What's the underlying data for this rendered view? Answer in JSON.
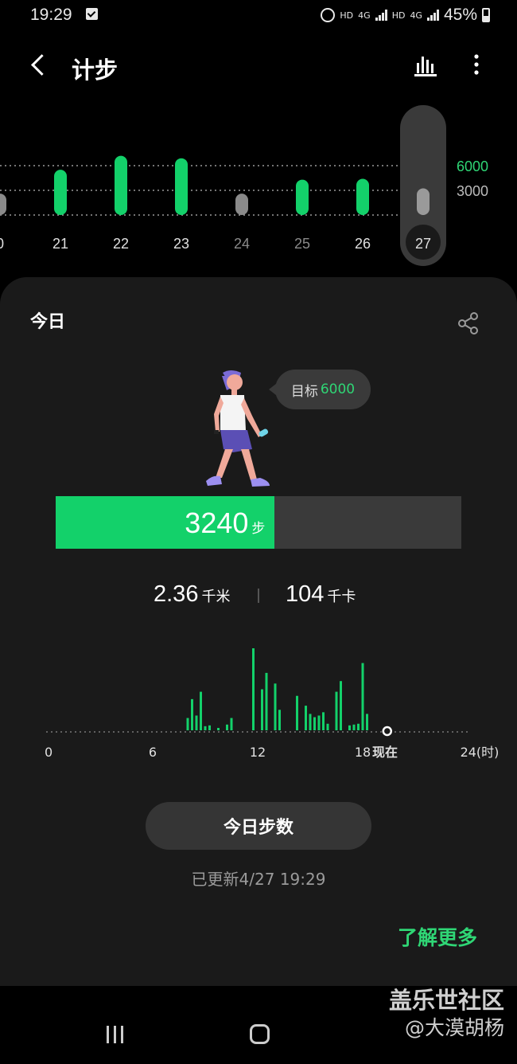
{
  "status_bar": {
    "time": "19:29",
    "hd1": "HD",
    "net1": "4G",
    "hd2": "HD",
    "net2": "4G",
    "battery": "45%"
  },
  "header": {
    "title": "计步"
  },
  "week_chart": {
    "chart_data": {
      "type": "bar",
      "categories": [
        "0",
        "21",
        "22",
        "23",
        "24",
        "25",
        "26",
        "27"
      ],
      "values": [
        2600,
        5500,
        7200,
        6900,
        2600,
        4300,
        4400,
        3240
      ],
      "goal": 6000,
      "reference_lines": [
        6000,
        3000
      ],
      "y_labels": [
        "6000",
        "3000"
      ],
      "selected": "27"
    },
    "colors": {
      "met": "#13d16a",
      "low": "#8a8a8a",
      "selected": "#9a9a9a"
    }
  },
  "card": {
    "title": "今日",
    "goal_label": "目标",
    "goal_value": "6000",
    "steps": "3240",
    "steps_unit": "步",
    "progress": 0.54,
    "distance": "2.36",
    "distance_unit": "千米",
    "calories": "104",
    "calories_unit": "千卡",
    "hourly_chart": {
      "chart_data": {
        "type": "bar",
        "x_ticks": [
          "0",
          "6",
          "12",
          "18",
          "24(时)"
        ],
        "now_label": "现在",
        "now_hour": 19.4,
        "bars": [
          [
            8.0,
            150
          ],
          [
            8.25,
            380
          ],
          [
            8.5,
            180
          ],
          [
            8.75,
            470
          ],
          [
            9.0,
            50
          ],
          [
            9.25,
            60
          ],
          [
            9.75,
            20
          ],
          [
            10.25,
            70
          ],
          [
            10.5,
            150
          ],
          [
            11.75,
            1000
          ],
          [
            12.25,
            500
          ],
          [
            12.5,
            700
          ],
          [
            13.0,
            570
          ],
          [
            13.25,
            250
          ],
          [
            14.25,
            420
          ],
          [
            14.75,
            300
          ],
          [
            15.0,
            200
          ],
          [
            15.25,
            160
          ],
          [
            15.5,
            180
          ],
          [
            15.75,
            220
          ],
          [
            16.0,
            80
          ],
          [
            16.5,
            470
          ],
          [
            16.75,
            600
          ],
          [
            17.25,
            60
          ],
          [
            17.5,
            70
          ],
          [
            17.75,
            80
          ],
          [
            18.0,
            820
          ],
          [
            18.25,
            200
          ]
        ]
      }
    },
    "today_button": "今日步数",
    "updated": "已更新4/27 19:29",
    "learn_more": "了解更多"
  },
  "watermark": {
    "line1": "盖乐世社区",
    "line2": "@大漠胡杨"
  }
}
